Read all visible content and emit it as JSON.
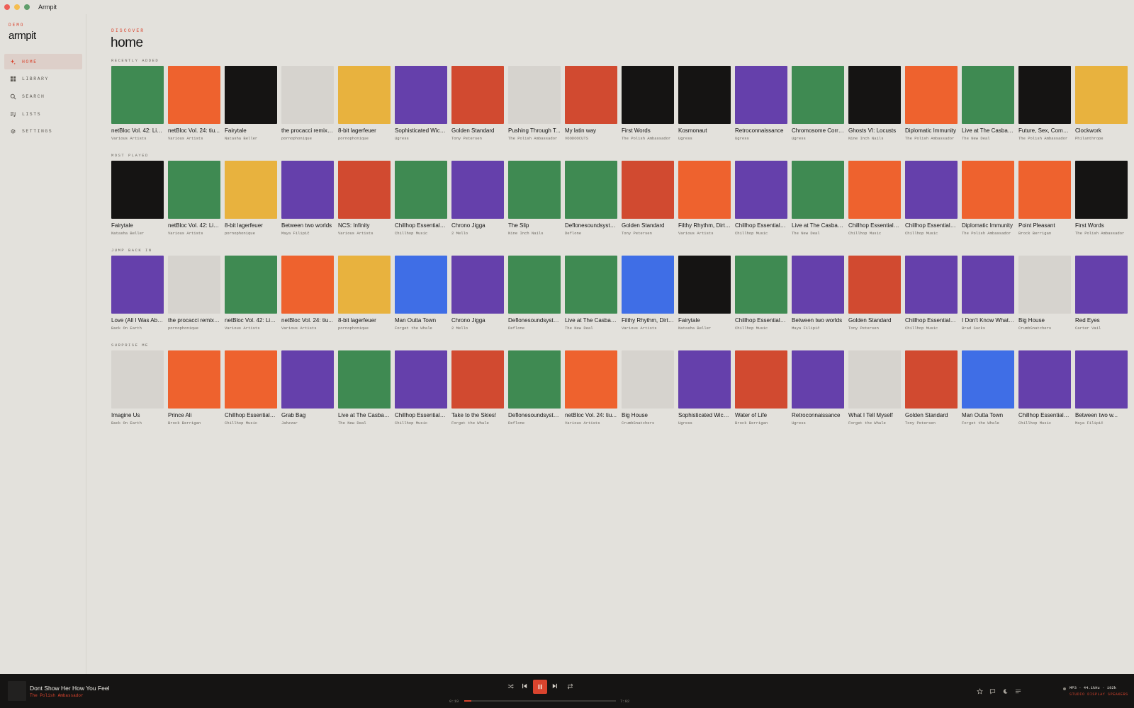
{
  "window": {
    "title": "Armpit",
    "lights": [
      "#ee5f57",
      "#f5bd4f",
      "#5f9e6c"
    ]
  },
  "sidebar": {
    "brand_tag": "DEMO",
    "brand": "armpit",
    "items": [
      {
        "label": "HOME",
        "icon": "sparkle-icon",
        "active": true
      },
      {
        "label": "LIBRARY",
        "icon": "grid-icon",
        "active": false
      },
      {
        "label": "SEARCH",
        "icon": "search-icon",
        "active": false
      },
      {
        "label": "LISTS",
        "icon": "list-music-icon",
        "active": false
      },
      {
        "label": "SETTINGS",
        "icon": "gear-icon",
        "active": false
      }
    ]
  },
  "main": {
    "eyebrow": "DISCOVER",
    "title": "home"
  },
  "colors": {
    "accent": "#d9442e",
    "green": "#3f8a52",
    "orange": "#ee622e",
    "black": "#151413",
    "grey": "#d6d3ce",
    "yellow": "#e8b23e",
    "purple": "#6540ab",
    "red": "#d14a30",
    "blue": "#3f6ee6"
  },
  "sections": [
    {
      "label": "RECENTLY ADDED",
      "items": [
        {
          "title": "netBloc Vol. 42: Liv...",
          "artist": "Various Artists",
          "color": "green"
        },
        {
          "title": "netBloc Vol. 24: tiu...",
          "artist": "Various Artists",
          "color": "orange"
        },
        {
          "title": "Fairytale",
          "artist": "Natasha Beller",
          "color": "black"
        },
        {
          "title": "the procacci remixe...",
          "artist": "pornophonique",
          "color": "grey"
        },
        {
          "title": "8-bit lagerfeuer",
          "artist": "pornophonique",
          "color": "yellow"
        },
        {
          "title": "Sophisticated Wick...",
          "artist": "Ugress",
          "color": "purple"
        },
        {
          "title": "Golden Standard",
          "artist": "Tony Petersen",
          "color": "red"
        },
        {
          "title": "Pushing Through T...",
          "artist": "The Polish Ambassador",
          "color": "grey"
        },
        {
          "title": "My latin way",
          "artist": "VOODOOCUTS",
          "color": "red"
        },
        {
          "title": "First Words",
          "artist": "The Polish Ambassador",
          "color": "black"
        },
        {
          "title": "Kosmonaut",
          "artist": "Ugress",
          "color": "black"
        },
        {
          "title": "Retroconnaissance",
          "artist": "Ugress",
          "color": "purple"
        },
        {
          "title": "Chromosome Corru...",
          "artist": "Ugress",
          "color": "green"
        },
        {
          "title": "Ghosts VI: Locusts",
          "artist": "Nine Inch Nails",
          "color": "black"
        },
        {
          "title": "Diplomatic Immunity",
          "artist": "The Polish Ambassador",
          "color": "orange"
        },
        {
          "title": "Live at The Casbah...",
          "artist": "The New Deal",
          "color": "green"
        },
        {
          "title": "Future, Sex, Compu...",
          "artist": "The Polish Ambassador",
          "color": "black"
        },
        {
          "title": "Clockwork",
          "artist": "Philanthrope",
          "color": "yellow"
        }
      ]
    },
    {
      "label": "MOST PLAYED",
      "items": [
        {
          "title": "Fairytale",
          "artist": "Natasha Beller",
          "color": "black"
        },
        {
          "title": "netBloc Vol. 42: Liv...",
          "artist": "Various Artists",
          "color": "green"
        },
        {
          "title": "8-bit lagerfeuer",
          "artist": "pornophonique",
          "color": "yellow"
        },
        {
          "title": "Between two worlds",
          "artist": "Maya Filipič",
          "color": "purple"
        },
        {
          "title": "NCS: Infinity",
          "artist": "Various Artists",
          "color": "red"
        },
        {
          "title": "Chillhop Essentials...",
          "artist": "Chillhop Music",
          "color": "green"
        },
        {
          "title": "Chrono Jigga",
          "artist": "2 Mello",
          "color": "purple"
        },
        {
          "title": "The Slip",
          "artist": "Nine Inch Nails",
          "color": "green"
        },
        {
          "title": "Deflonesoundsystem",
          "artist": "Deflone",
          "color": "green"
        },
        {
          "title": "Golden Standard",
          "artist": "Tony Petersen",
          "color": "red"
        },
        {
          "title": "Filthy Rhythm, Dirty...",
          "artist": "Various Artists",
          "color": "orange"
        },
        {
          "title": "Chillhop Essentials...",
          "artist": "Chillhop Music",
          "color": "purple"
        },
        {
          "title": "Live at The Casbah...",
          "artist": "The New Deal",
          "color": "green"
        },
        {
          "title": "Chillhop Essentials...",
          "artist": "Chillhop Music",
          "color": "orange"
        },
        {
          "title": "Chillhop Essentials...",
          "artist": "Chillhop Music",
          "color": "purple"
        },
        {
          "title": "Diplomatic Immunity",
          "artist": "The Polish Ambassador",
          "color": "orange"
        },
        {
          "title": "Point Pleasant",
          "artist": "Brock Berrigan",
          "color": "orange"
        },
        {
          "title": "First Words",
          "artist": "The Polish Ambassador",
          "color": "black"
        }
      ]
    },
    {
      "label": "JUMP BACK IN",
      "items": [
        {
          "title": "Love (All I Was Able...",
          "artist": "Back On Earth",
          "color": "purple"
        },
        {
          "title": "the procacci remixe...",
          "artist": "pornophonique",
          "color": "grey"
        },
        {
          "title": "netBloc Vol. 42: Liv...",
          "artist": "Various Artists",
          "color": "green"
        },
        {
          "title": "netBloc Vol. 24: tiu...",
          "artist": "Various Artists",
          "color": "orange"
        },
        {
          "title": "8-bit lagerfeuer",
          "artist": "pornophonique",
          "color": "yellow"
        },
        {
          "title": "Man Outta Town",
          "artist": "Forget the Whale",
          "color": "blue"
        },
        {
          "title": "Chrono Jigga",
          "artist": "2 Mello",
          "color": "purple"
        },
        {
          "title": "Deflonesoundsystem",
          "artist": "Deflone",
          "color": "green"
        },
        {
          "title": "Live at The Casbah...",
          "artist": "The New Deal",
          "color": "green"
        },
        {
          "title": "Filthy Rhythm, Dirty...",
          "artist": "Various Artists",
          "color": "blue"
        },
        {
          "title": "Fairytale",
          "artist": "Natasha Beller",
          "color": "black"
        },
        {
          "title": "Chillhop Essentials...",
          "artist": "Chillhop Music",
          "color": "green"
        },
        {
          "title": "Between two worlds",
          "artist": "Maya Filipič",
          "color": "purple"
        },
        {
          "title": "Golden Standard",
          "artist": "Tony Petersen",
          "color": "red"
        },
        {
          "title": "Chillhop Essentials...",
          "artist": "Chillhop Music",
          "color": "purple"
        },
        {
          "title": "I Don't Know What I...",
          "artist": "Brad Sucks",
          "color": "purple"
        },
        {
          "title": "Big House",
          "artist": "CrumbSnatchers",
          "color": "grey"
        },
        {
          "title": "Red Eyes",
          "artist": "Carter Vail",
          "color": "purple"
        }
      ]
    },
    {
      "label": "SURPRISE ME",
      "items": [
        {
          "title": "Imagine Us",
          "artist": "Back On Earth",
          "color": "grey"
        },
        {
          "title": "Prince Ali",
          "artist": "Brock Berrigan",
          "color": "orange"
        },
        {
          "title": "Chillhop Essentials...",
          "artist": "Chillhop Music",
          "color": "orange"
        },
        {
          "title": "Grab Bag",
          "artist": "Jahzzar",
          "color": "purple"
        },
        {
          "title": "Live at The Casbah...",
          "artist": "The New Deal",
          "color": "green"
        },
        {
          "title": "Chillhop Essentials...",
          "artist": "Chillhop Music",
          "color": "purple"
        },
        {
          "title": "Take to the Skies!",
          "artist": "Forget the Whale",
          "color": "red"
        },
        {
          "title": "Deflonesoundsystem",
          "artist": "Deflone",
          "color": "green"
        },
        {
          "title": "netBloc Vol. 24: tiu...",
          "artist": "Various Artists",
          "color": "orange"
        },
        {
          "title": "Big House",
          "artist": "CrumbSnatchers",
          "color": "grey"
        },
        {
          "title": "Sophisticated Wick...",
          "artist": "Ugress",
          "color": "purple"
        },
        {
          "title": "Water of Life",
          "artist": "Brock Berrigan",
          "color": "red"
        },
        {
          "title": "Retroconnaissance",
          "artist": "Ugress",
          "color": "purple"
        },
        {
          "title": "What I Tell Myself",
          "artist": "Forget the Whale",
          "color": "grey"
        },
        {
          "title": "Golden Standard",
          "artist": "Tony Petersen",
          "color": "red"
        },
        {
          "title": "Man Outta Town",
          "artist": "Forget the Whale",
          "color": "blue"
        },
        {
          "title": "Chillhop Essentials...",
          "artist": "Chillhop Music",
          "color": "purple"
        },
        {
          "title": "Between two w...",
          "artist": "Maya Filipič",
          "color": "purple"
        }
      ]
    }
  ],
  "player": {
    "track": "Dont Show Her How You Feel",
    "artist": "The Polish Ambassador",
    "elapsed": "0:19",
    "duration": "7:02",
    "progress_fraction": 0.045,
    "format": "MP3 · 44.1kHz · 192k",
    "output": "STUDIO DISPLAY SPEAKERS"
  }
}
